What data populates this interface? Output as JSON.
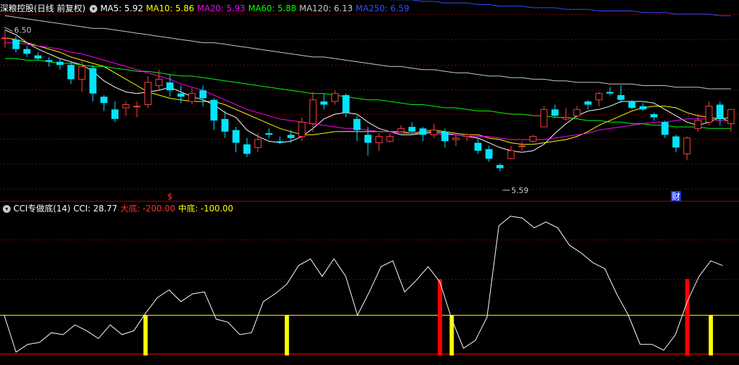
{
  "main_header": {
    "title": "深粮控股(日线 前复权)",
    "indicators": [
      {
        "label": "MA5: 5.92",
        "color": "#ffffff"
      },
      {
        "label": "MA10: 5.86",
        "color": "#ffff00"
      },
      {
        "label": "MA20: 5.93",
        "color": "#ff00ff"
      },
      {
        "label": "MA60: 5.88",
        "color": "#00ff00"
      },
      {
        "label": "MA120: 6.13",
        "color": "#c8c8c8"
      },
      {
        "label": "MA250: 6.59",
        "color": "#3050ff"
      }
    ]
  },
  "sub_header": {
    "title": "CCI专做底(14)",
    "indicators": [
      {
        "label": "CCI: 28.77",
        "color": "#ffffff"
      },
      {
        "label": "大底: -200.00",
        "color": "#ff3030"
      },
      {
        "label": "中底: -100.00",
        "color": "#ffff00"
      }
    ]
  },
  "colors": {
    "up": "#ff4040",
    "down": "#00e5ff",
    "grid": "#7a0000",
    "ma5": "#ffffff",
    "ma10": "#ffff00",
    "ma20": "#ff00ff",
    "ma60": "#00ff00",
    "ma120": "#c8c8c8",
    "ma250": "#3050ff",
    "cci": "#ffffff",
    "da_di": "#ff0000",
    "zhong_di": "#ffff00"
  },
  "price_labels": {
    "high": "6.50",
    "low": "5.59"
  },
  "event_markers": [
    {
      "text": "$",
      "bar": 15,
      "color": "#ff3030"
    },
    {
      "text": "财",
      "bar": 61,
      "color": "#ffffff",
      "bg": "#1e3cff"
    }
  ],
  "chart_data": [
    {
      "type": "candlestick",
      "ylim": [
        5.5,
        6.6
      ],
      "candles": [
        [
          6.45,
          6.5,
          6.39,
          6.45
        ],
        [
          6.44,
          6.46,
          6.36,
          6.38
        ],
        [
          6.38,
          6.4,
          6.33,
          6.35
        ],
        [
          6.34,
          6.36,
          6.31,
          6.32
        ],
        [
          6.31,
          6.33,
          6.27,
          6.3
        ],
        [
          6.3,
          6.32,
          6.25,
          6.28
        ],
        [
          6.28,
          6.3,
          6.16,
          6.19
        ],
        [
          6.19,
          6.31,
          6.11,
          6.27
        ],
        [
          6.26,
          6.28,
          6.05,
          6.1
        ],
        [
          6.08,
          6.09,
          5.99,
          6.04
        ],
        [
          6.0,
          6.05,
          5.92,
          5.94
        ],
        [
          6.01,
          6.05,
          5.96,
          6.03
        ],
        [
          6.02,
          6.05,
          5.95,
          6.02
        ],
        [
          6.03,
          6.21,
          6.01,
          6.17
        ],
        [
          6.15,
          6.25,
          6.12,
          6.19
        ],
        [
          6.17,
          6.22,
          6.08,
          6.12
        ],
        [
          6.1,
          6.15,
          6.04,
          6.08
        ],
        [
          6.05,
          6.14,
          6.03,
          6.1
        ],
        [
          6.12,
          6.15,
          6.02,
          6.07
        ],
        [
          6.06,
          6.07,
          5.87,
          5.93
        ],
        [
          5.94,
          5.99,
          5.82,
          5.86
        ],
        [
          5.87,
          5.89,
          5.73,
          5.79
        ],
        [
          5.78,
          5.82,
          5.7,
          5.72
        ],
        [
          5.76,
          5.85,
          5.73,
          5.81
        ],
        [
          5.85,
          5.88,
          5.82,
          5.84
        ],
        [
          5.8,
          5.83,
          5.78,
          5.79
        ],
        [
          5.84,
          5.87,
          5.79,
          5.82
        ],
        [
          5.83,
          5.95,
          5.8,
          5.92
        ],
        [
          5.91,
          6.11,
          5.86,
          6.06
        ],
        [
          6.05,
          6.1,
          6.0,
          6.03
        ],
        [
          6.05,
          6.12,
          6.03,
          6.1
        ],
        [
          6.09,
          6.1,
          5.95,
          5.98
        ],
        [
          5.94,
          5.96,
          5.8,
          5.87
        ],
        [
          5.84,
          5.89,
          5.71,
          5.79
        ],
        [
          5.79,
          5.85,
          5.74,
          5.83
        ],
        [
          5.8,
          5.85,
          5.79,
          5.83
        ],
        [
          5.86,
          5.9,
          5.86,
          5.88
        ],
        [
          5.89,
          5.92,
          5.84,
          5.86
        ],
        [
          5.88,
          5.89,
          5.8,
          5.84
        ],
        [
          5.84,
          5.91,
          5.82,
          5.87
        ],
        [
          5.86,
          5.88,
          5.76,
          5.8
        ],
        [
          5.81,
          5.84,
          5.77,
          5.82
        ],
        [
          5.83,
          5.85,
          5.8,
          5.84
        ],
        [
          5.79,
          5.82,
          5.72,
          5.74
        ],
        [
          5.75,
          5.77,
          5.67,
          5.69
        ],
        [
          5.65,
          5.66,
          5.61,
          5.63
        ],
        [
          5.69,
          5.77,
          5.69,
          5.74
        ],
        [
          5.77,
          5.8,
          5.74,
          5.77
        ],
        [
          5.8,
          5.84,
          5.79,
          5.83
        ],
        [
          5.89,
          6.02,
          5.89,
          6.0
        ],
        [
          6.0,
          6.03,
          5.95,
          5.96
        ],
        [
          5.94,
          6.01,
          5.93,
          5.95
        ],
        [
          5.96,
          6.02,
          5.94,
          6.0
        ],
        [
          6.05,
          6.06,
          6.0,
          6.03
        ],
        [
          6.06,
          6.11,
          6.02,
          6.1
        ],
        [
          6.11,
          6.14,
          6.09,
          6.1
        ],
        [
          6.09,
          6.15,
          6.04,
          6.06
        ],
        [
          6.05,
          6.06,
          6.0,
          6.01
        ],
        [
          6.02,
          6.04,
          5.99,
          6.0
        ],
        [
          5.97,
          5.98,
          5.93,
          5.95
        ],
        [
          5.92,
          5.93,
          5.82,
          5.84
        ],
        [
          5.83,
          5.84,
          5.73,
          5.76
        ],
        [
          5.72,
          5.83,
          5.68,
          5.82
        ],
        [
          5.88,
          5.97,
          5.86,
          5.93
        ],
        [
          5.92,
          6.05,
          5.9,
          6.02
        ],
        [
          6.03,
          6.05,
          5.9,
          5.94
        ],
        [
          5.91,
          6.0,
          5.86,
          6.0
        ]
      ],
      "series": [
        {
          "name": "MA5",
          "color": "#ffffff",
          "values": [
            6.5,
            6.47,
            6.42,
            6.38,
            6.35,
            6.32,
            6.3,
            6.28,
            6.24,
            6.18,
            6.14,
            6.11,
            6.1,
            6.11,
            6.12,
            6.14,
            6.11,
            6.08,
            6.06,
            6.03,
            5.98,
            5.95,
            5.87,
            5.83,
            5.8,
            5.79,
            5.8,
            5.83,
            5.88,
            5.94,
            5.97,
            5.98,
            5.97,
            5.92,
            5.88,
            5.86,
            5.84,
            5.84,
            5.85,
            5.86,
            5.85,
            5.84,
            5.83,
            5.82,
            5.79,
            5.76,
            5.74,
            5.73,
            5.74,
            5.78,
            5.85,
            5.91,
            5.96,
            5.99,
            6.0,
            6.02,
            6.05,
            6.05,
            6.05,
            6.04,
            6.0,
            5.96,
            5.92,
            5.9,
            5.92,
            5.95,
            5.92
          ]
        },
        {
          "name": "MA10",
          "color": "#ffff00",
          "values": [
            6.45,
            6.44,
            6.42,
            6.4,
            6.38,
            6.36,
            6.33,
            6.31,
            6.29,
            6.27,
            6.23,
            6.19,
            6.15,
            6.11,
            6.09,
            6.07,
            6.06,
            6.05,
            6.05,
            6.05,
            6.03,
            6.0,
            5.97,
            5.94,
            5.91,
            5.88,
            5.86,
            5.84,
            5.84,
            5.85,
            5.86,
            5.86,
            5.86,
            5.86,
            5.86,
            5.86,
            5.86,
            5.85,
            5.86,
            5.87,
            5.86,
            5.85,
            5.84,
            5.84,
            5.82,
            5.81,
            5.79,
            5.78,
            5.78,
            5.79,
            5.8,
            5.81,
            5.83,
            5.86,
            5.9,
            5.93,
            5.96,
            5.99,
            6.01,
            6.02,
            6.02,
            6.01,
            5.98,
            5.96,
            5.95,
            5.94,
            5.95
          ]
        },
        {
          "name": "MA20",
          "color": "#ff00ff",
          "values": [
            6.42,
            6.42,
            6.41,
            6.4,
            6.39,
            6.38,
            6.36,
            6.35,
            6.33,
            6.31,
            6.29,
            6.27,
            6.25,
            6.23,
            6.21,
            6.19,
            6.16,
            6.14,
            6.12,
            6.09,
            6.06,
            6.03,
            6.0,
            5.98,
            5.96,
            5.94,
            5.93,
            5.92,
            5.91,
            5.9,
            5.89,
            5.88,
            5.88,
            5.87,
            5.86,
            5.86,
            5.85,
            5.85,
            5.85,
            5.85,
            5.84,
            5.84,
            5.83,
            5.83,
            5.83,
            5.82,
            5.81,
            5.81,
            5.81,
            5.81,
            5.82,
            5.83,
            5.84,
            5.85,
            5.87,
            5.88,
            5.89,
            5.9,
            5.91,
            5.92,
            5.92,
            5.93,
            5.94,
            5.94,
            5.94,
            5.93,
            5.93
          ]
        },
        {
          "name": "MA60",
          "color": "#00ff00",
          "values": [
            6.32,
            6.32,
            6.31,
            6.31,
            6.3,
            6.29,
            6.29,
            6.28,
            6.27,
            6.27,
            6.26,
            6.25,
            6.24,
            6.24,
            6.23,
            6.22,
            6.21,
            6.21,
            6.2,
            6.19,
            6.18,
            6.17,
            6.16,
            6.15,
            6.14,
            6.13,
            6.12,
            6.11,
            6.1,
            6.1,
            6.09,
            6.08,
            6.07,
            6.06,
            6.06,
            6.05,
            6.04,
            6.03,
            6.03,
            6.02,
            6.01,
            6.01,
            6.0,
            5.99,
            5.99,
            5.98,
            5.97,
            5.97,
            5.96,
            5.96,
            5.95,
            5.95,
            5.94,
            5.93,
            5.93,
            5.92,
            5.92,
            5.91,
            5.91,
            5.9,
            5.9,
            5.89,
            5.89,
            5.89,
            5.88,
            5.88,
            5.88
          ]
        },
        {
          "name": "MA120",
          "color": "#c8c8c8",
          "values": [
            6.59,
            6.58,
            6.57,
            6.56,
            6.55,
            6.54,
            6.53,
            6.52,
            6.51,
            6.51,
            6.5,
            6.49,
            6.48,
            6.47,
            6.46,
            6.45,
            6.44,
            6.43,
            6.42,
            6.42,
            6.41,
            6.4,
            6.39,
            6.38,
            6.37,
            6.36,
            6.35,
            6.34,
            6.33,
            6.33,
            6.32,
            6.31,
            6.3,
            6.29,
            6.28,
            6.27,
            6.27,
            6.26,
            6.25,
            6.25,
            6.24,
            6.23,
            6.23,
            6.22,
            6.21,
            6.21,
            6.2,
            6.2,
            6.19,
            6.19,
            6.18,
            6.18,
            6.17,
            6.17,
            6.17,
            6.16,
            6.16,
            6.16,
            6.15,
            6.15,
            6.15,
            6.14,
            6.14,
            6.14,
            6.13,
            6.13,
            6.13
          ]
        },
        {
          "name": "MA250",
          "color": "#3050ff",
          "values": [
            6.86,
            6.86,
            6.85,
            6.85,
            6.84,
            6.84,
            6.83,
            6.83,
            6.82,
            6.82,
            6.81,
            6.81,
            6.8,
            6.8,
            6.79,
            6.79,
            6.78,
            6.78,
            6.77,
            6.77,
            6.76,
            6.76,
            6.75,
            6.75,
            6.74,
            6.74,
            6.73,
            6.73,
            6.72,
            6.72,
            6.72,
            6.71,
            6.71,
            6.7,
            6.7,
            6.69,
            6.69,
            6.69,
            6.68,
            6.68,
            6.67,
            6.67,
            6.67,
            6.66,
            6.66,
            6.65,
            6.65,
            6.65,
            6.64,
            6.64,
            6.64,
            6.63,
            6.63,
            6.63,
            6.62,
            6.62,
            6.62,
            6.62,
            6.61,
            6.61,
            6.61,
            6.6,
            6.6,
            6.6,
            6.6,
            6.59,
            6.59
          ]
        }
      ]
    },
    {
      "type": "line",
      "ylim": [
        -210,
        160
      ],
      "reference_lines": [
        -200,
        -100
      ],
      "series": [
        {
          "name": "CCI",
          "values": [
            -100,
            -195,
            -175,
            -170,
            -145,
            -150,
            -125,
            -140,
            -160,
            -125,
            -150,
            -140,
            -95,
            -55,
            -35,
            -65,
            -45,
            -40,
            -110,
            -118,
            -150,
            -145,
            -65,
            -45,
            -20,
            28,
            45,
            0,
            45,
            0,
            -100,
            -40,
            25,
            40,
            -40,
            -10,
            25,
            -15,
            -110,
            -185,
            -165,
            -105,
            130,
            155,
            150,
            125,
            140,
            125,
            80,
            60,
            35,
            20,
            -45,
            -100,
            -175,
            -175,
            -190,
            -150,
            -65,
            0,
            40,
            28
          ]
        }
      ],
      "bars": [
        {
          "index": 12,
          "value": -100,
          "color": "#ffff00"
        },
        {
          "index": 24,
          "value": -100,
          "color": "#ffff00"
        },
        {
          "index": 37,
          "value": -200,
          "color": "#ff0000"
        },
        {
          "index": 38,
          "value": -100,
          "color": "#ffff00"
        },
        {
          "index": 58,
          "value": -200,
          "color": "#ff0000"
        },
        {
          "index": 60,
          "value": -100,
          "color": "#ffff00"
        }
      ]
    }
  ]
}
